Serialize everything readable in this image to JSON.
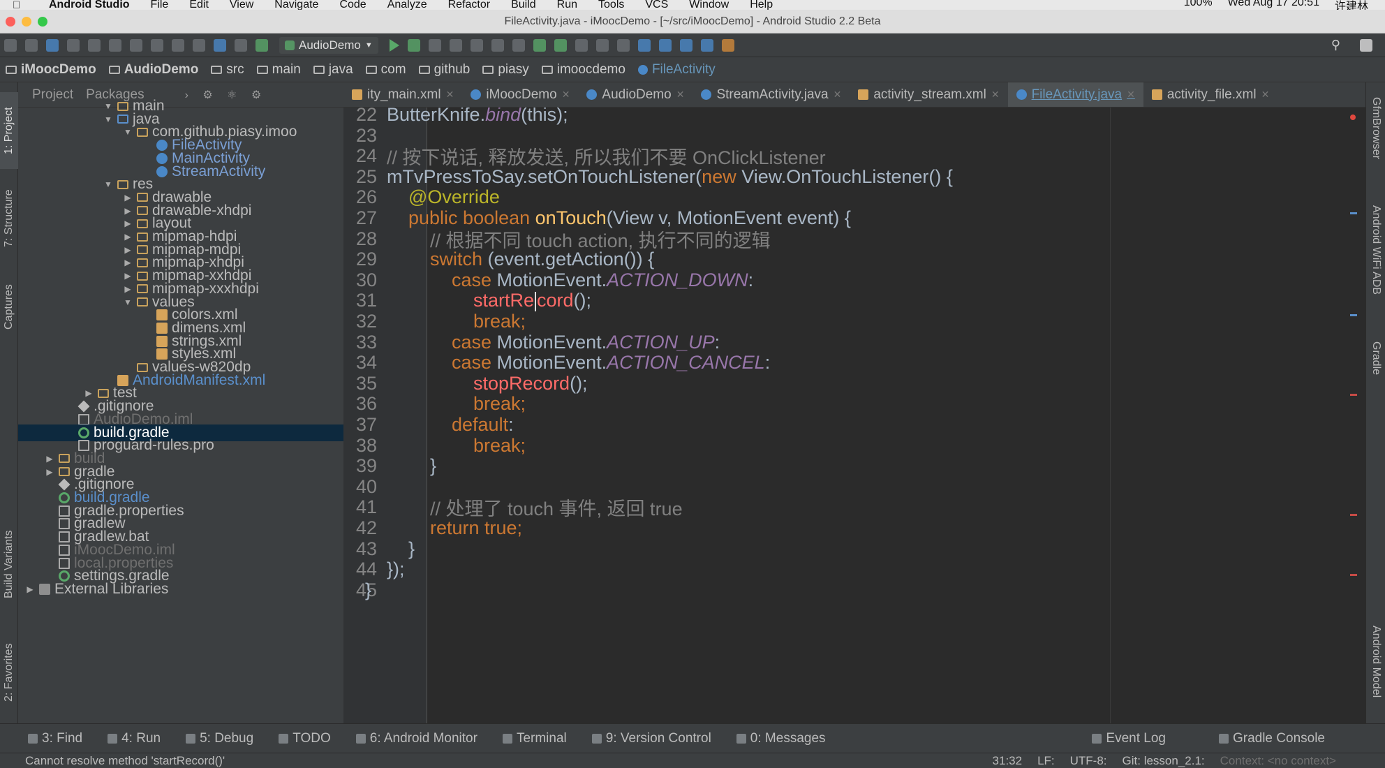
{
  "mac_menubar": {
    "app_name": "Android Studio",
    "items": [
      "File",
      "Edit",
      "View",
      "Navigate",
      "Code",
      "Analyze",
      "Refactor",
      "Build",
      "Run",
      "Tools",
      "VCS",
      "Window",
      "Help"
    ],
    "battery": "100%",
    "datetime": "Wed Aug 17  20:51",
    "user": "许建林"
  },
  "window": {
    "title": "FileActivity.java - iMoocDemo - [~/src/iMoocDemo] - Android Studio 2.2 Beta"
  },
  "toolbar": {
    "run_config": "AudioDemo"
  },
  "breadcrumb": [
    "iMoocDemo",
    "AudioDemo",
    "src",
    "main",
    "java",
    "com",
    "github",
    "piasy",
    "imoocdemo",
    "FileActivity"
  ],
  "project_panel": {
    "view_tabs": [
      "Project",
      "Packages"
    ],
    "tree": [
      {
        "label": "main",
        "icon": "folder",
        "level": 4,
        "arrow": "down",
        "style": "normal"
      },
      {
        "label": "java",
        "icon": "src",
        "level": 4,
        "arrow": "down",
        "style": "normal"
      },
      {
        "label": "com.github.piasy.imoo",
        "icon": "folder",
        "level": 5,
        "arrow": "down",
        "style": "normal"
      },
      {
        "label": "FileActivity",
        "icon": "class",
        "level": 6,
        "arrow": "",
        "style": "cls"
      },
      {
        "label": "MainActivity",
        "icon": "class",
        "level": 6,
        "arrow": "",
        "style": "cls"
      },
      {
        "label": "StreamActivity",
        "icon": "class",
        "level": 6,
        "arrow": "",
        "style": "cls"
      },
      {
        "label": "res",
        "icon": "folder",
        "level": 4,
        "arrow": "down",
        "style": "normal"
      },
      {
        "label": "drawable",
        "icon": "folder",
        "level": 5,
        "arrow": "right",
        "style": "normal"
      },
      {
        "label": "drawable-xhdpi",
        "icon": "folder",
        "level": 5,
        "arrow": "right",
        "style": "normal"
      },
      {
        "label": "layout",
        "icon": "folder",
        "level": 5,
        "arrow": "right",
        "style": "normal"
      },
      {
        "label": "mipmap-hdpi",
        "icon": "folder",
        "level": 5,
        "arrow": "right",
        "style": "normal"
      },
      {
        "label": "mipmap-mdpi",
        "icon": "folder",
        "level": 5,
        "arrow": "right",
        "style": "normal"
      },
      {
        "label": "mipmap-xhdpi",
        "icon": "folder",
        "level": 5,
        "arrow": "right",
        "style": "normal"
      },
      {
        "label": "mipmap-xxhdpi",
        "icon": "folder",
        "level": 5,
        "arrow": "right",
        "style": "normal"
      },
      {
        "label": "mipmap-xxxhdpi",
        "icon": "folder",
        "level": 5,
        "arrow": "right",
        "style": "normal"
      },
      {
        "label": "values",
        "icon": "folder",
        "level": 5,
        "arrow": "down",
        "style": "normal"
      },
      {
        "label": "colors.xml",
        "icon": "xml",
        "level": 6,
        "arrow": "",
        "style": "normal"
      },
      {
        "label": "dimens.xml",
        "icon": "xml",
        "level": 6,
        "arrow": "",
        "style": "normal"
      },
      {
        "label": "strings.xml",
        "icon": "xml",
        "level": 6,
        "arrow": "",
        "style": "normal"
      },
      {
        "label": "styles.xml",
        "icon": "xml",
        "level": 6,
        "arrow": "",
        "style": "normal"
      },
      {
        "label": "values-w820dp",
        "icon": "folder",
        "level": 5,
        "arrow": "",
        "style": "normal"
      },
      {
        "label": "AndroidManifest.xml",
        "icon": "xml",
        "level": 4,
        "arrow": "",
        "style": "blue"
      },
      {
        "label": "test",
        "icon": "folder",
        "level": 3,
        "arrow": "right",
        "style": "normal"
      },
      {
        "label": ".gitignore",
        "icon": "git",
        "level": 2,
        "arrow": "",
        "style": "normal"
      },
      {
        "label": "AudioDemo.iml",
        "icon": "file",
        "level": 2,
        "arrow": "",
        "style": "dim"
      },
      {
        "label": "build.gradle",
        "icon": "gradle",
        "level": 2,
        "arrow": "",
        "style": "sel"
      },
      {
        "label": "proguard-rules.pro",
        "icon": "file",
        "level": 2,
        "arrow": "",
        "style": "normal"
      },
      {
        "label": "build",
        "icon": "folder",
        "level": 1,
        "arrow": "right",
        "style": "dim"
      },
      {
        "label": "gradle",
        "icon": "folder",
        "level": 1,
        "arrow": "right",
        "style": "normal"
      },
      {
        "label": ".gitignore",
        "icon": "git",
        "level": 1,
        "arrow": "",
        "style": "normal"
      },
      {
        "label": "build.gradle",
        "icon": "gradle",
        "level": 1,
        "arrow": "",
        "style": "blue"
      },
      {
        "label": "gradle.properties",
        "icon": "file",
        "level": 1,
        "arrow": "",
        "style": "normal"
      },
      {
        "label": "gradlew",
        "icon": "file",
        "level": 1,
        "arrow": "",
        "style": "normal"
      },
      {
        "label": "gradlew.bat",
        "icon": "file",
        "level": 1,
        "arrow": "",
        "style": "normal"
      },
      {
        "label": "iMoocDemo.iml",
        "icon": "file",
        "level": 1,
        "arrow": "",
        "style": "dim"
      },
      {
        "label": "local.properties",
        "icon": "file",
        "level": 1,
        "arrow": "",
        "style": "dim"
      },
      {
        "label": "settings.gradle",
        "icon": "gradle",
        "level": 1,
        "arrow": "",
        "style": "normal"
      },
      {
        "label": "External Libraries",
        "icon": "lib",
        "level": 0,
        "arrow": "right",
        "style": "normal"
      }
    ]
  },
  "left_tool_tabs": [
    "1: Project",
    "7: Structure",
    "Captures",
    "Build Variants",
    "2: Favorites"
  ],
  "right_tool_tabs": [
    "GfmBrowser",
    "Android WiFi ADB",
    "Gradle",
    "Android Model"
  ],
  "editor_tabs": [
    {
      "label": "ity_main.xml",
      "icon": "xml",
      "active": false
    },
    {
      "label": "iMoocDemo",
      "icon": "c",
      "active": false
    },
    {
      "label": "AudioDemo",
      "icon": "c",
      "active": false
    },
    {
      "label": "StreamActivity.java",
      "icon": "c",
      "active": false
    },
    {
      "label": "activity_stream.xml",
      "icon": "xml",
      "active": false
    },
    {
      "label": "FileActivity.java",
      "icon": "c",
      "active": true
    },
    {
      "label": "activity_file.xml",
      "icon": "xml",
      "active": false
    }
  ],
  "editor": {
    "lines": [
      {
        "num": "22",
        "indent": 0,
        "tokens": [
          [
            "",
            "ButterKnife."
          ],
          [
            "it",
            "bind"
          ],
          [
            "",
            "(this);"
          ]
        ]
      },
      {
        "num": "23",
        "indent": 0,
        "tokens": []
      },
      {
        "num": "24",
        "indent": 0,
        "tokens": [
          [
            "cm",
            "// 按下说话, 释放发送, 所以我们不要 OnClickListener"
          ]
        ]
      },
      {
        "num": "25",
        "indent": 0,
        "tokens": [
          [
            "",
            "mTvPressToSay.setOnTouchListener("
          ],
          [
            "kw",
            "new "
          ],
          [
            "",
            "View.OnTouchListener() {"
          ]
        ]
      },
      {
        "num": "26",
        "indent": 1,
        "tokens": [
          [
            "an",
            "@Override"
          ]
        ]
      },
      {
        "num": "27",
        "indent": 1,
        "tokens": [
          [
            "kw",
            "public boolean "
          ],
          [
            "fn",
            "onTouch"
          ],
          [
            "",
            "(View v, MotionEvent event) {"
          ]
        ]
      },
      {
        "num": "28",
        "indent": 2,
        "tokens": [
          [
            "cm",
            "// 根据不同 touch action, 执行不同的逻辑"
          ]
        ]
      },
      {
        "num": "29",
        "indent": 2,
        "tokens": [
          [
            "kw",
            "switch "
          ],
          [
            "",
            "(event.getAction()) {"
          ]
        ]
      },
      {
        "num": "30",
        "indent": 3,
        "tokens": [
          [
            "kw",
            "case "
          ],
          [
            "",
            "MotionEvent."
          ],
          [
            "it",
            "ACTION_DOWN"
          ],
          [
            "",
            ":"
          ]
        ]
      },
      {
        "num": "31",
        "indent": 4,
        "tokens": [
          [
            "err",
            "startRe"
          ],
          [
            "caret",
            ""
          ],
          [
            "err",
            "cord"
          ],
          [
            "",
            "();"
          ]
        ]
      },
      {
        "num": "32",
        "indent": 4,
        "tokens": [
          [
            "kw",
            "break;"
          ]
        ]
      },
      {
        "num": "33",
        "indent": 3,
        "tokens": [
          [
            "kw",
            "case "
          ],
          [
            "",
            "MotionEvent."
          ],
          [
            "it",
            "ACTION_UP"
          ],
          [
            "",
            ":"
          ]
        ]
      },
      {
        "num": "34",
        "indent": 3,
        "tokens": [
          [
            "kw",
            "case "
          ],
          [
            "",
            "MotionEvent."
          ],
          [
            "it",
            "ACTION_CANCEL"
          ],
          [
            "",
            ":"
          ]
        ]
      },
      {
        "num": "35",
        "indent": 4,
        "tokens": [
          [
            "err",
            "stopRecord"
          ],
          [
            "",
            "();"
          ]
        ]
      },
      {
        "num": "36",
        "indent": 4,
        "tokens": [
          [
            "kw",
            "break;"
          ]
        ]
      },
      {
        "num": "37",
        "indent": 3,
        "tokens": [
          [
            "kw",
            "default"
          ],
          [
            "",
            ":"
          ]
        ]
      },
      {
        "num": "38",
        "indent": 4,
        "tokens": [
          [
            "kw",
            "break;"
          ]
        ]
      },
      {
        "num": "39",
        "indent": 2,
        "tokens": [
          [
            "",
            "}"
          ]
        ]
      },
      {
        "num": "40",
        "indent": 0,
        "tokens": []
      },
      {
        "num": "41",
        "indent": 2,
        "tokens": [
          [
            "cm",
            "// 处理了 touch 事件, 返回 true"
          ]
        ]
      },
      {
        "num": "42",
        "indent": 2,
        "tokens": [
          [
            "kw",
            "return true;"
          ]
        ]
      },
      {
        "num": "43",
        "indent": 1,
        "tokens": [
          [
            "",
            "}"
          ]
        ]
      },
      {
        "num": "44",
        "indent": 0,
        "tokens": [
          [
            "",
            "});"
          ]
        ]
      },
      {
        "num": "45",
        "indent": -1,
        "tokens": [
          [
            "",
            "}"
          ]
        ]
      }
    ]
  },
  "bottom_tools": [
    "3: Find",
    "4: Run",
    "5: Debug",
    "TODO",
    "6: Android Monitor",
    "Terminal",
    "9: Version Control",
    "0: Messages"
  ],
  "bottom_right_tools": [
    "Event Log",
    "Gradle Console"
  ],
  "statusbar": {
    "message": "Cannot resolve method 'startRecord()'",
    "position": "31:32",
    "line_sep": "LF:",
    "encoding": "UTF-8:",
    "git": "Git: lesson_2.1:",
    "context": "Context: <no context>"
  },
  "colors": {
    "keyword": "#cc7832",
    "comment": "#808080",
    "annotation": "#bbb529",
    "method": "#ffc66d",
    "error": "#ff6b68",
    "constant": "#9876aa",
    "text": "#a9b7c6"
  }
}
